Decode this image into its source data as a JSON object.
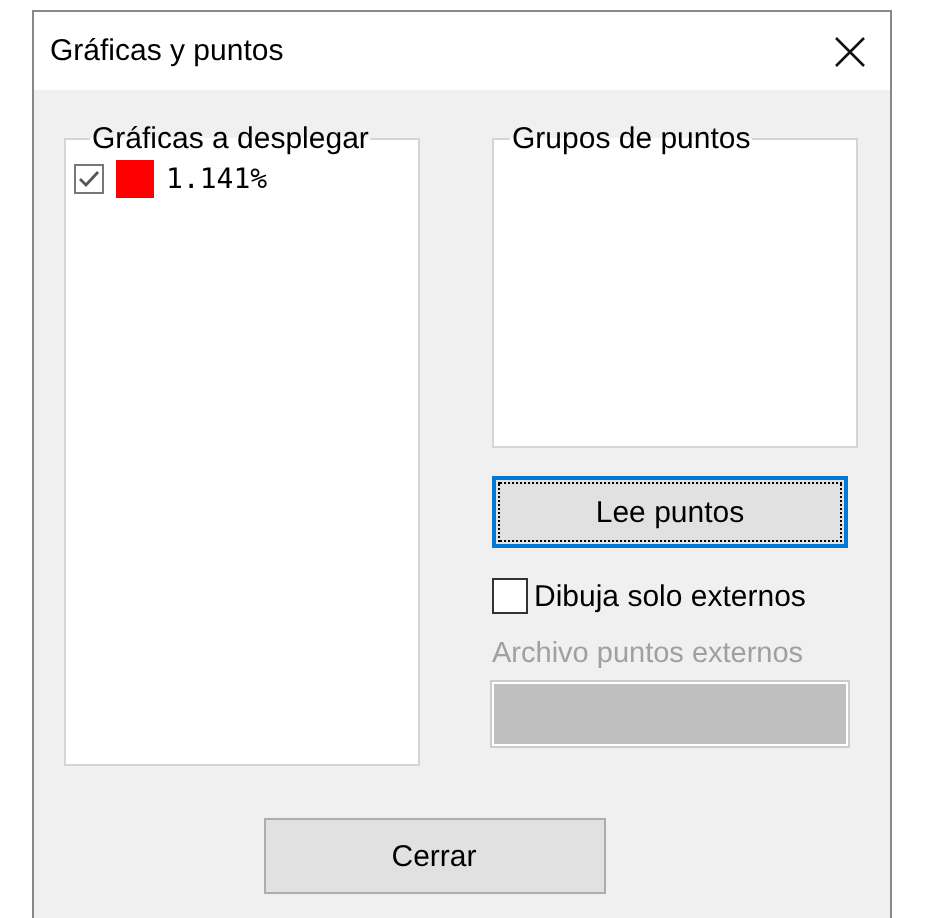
{
  "window": {
    "title": "Gráficas y puntos"
  },
  "graphs": {
    "label": "Gráficas a desplegar",
    "items": [
      {
        "checked": true,
        "color": "#ff0000",
        "label": "1.141%"
      }
    ]
  },
  "point_groups": {
    "label": "Grupos de puntos"
  },
  "read_button": {
    "label": "Lee puntos",
    "focused": true
  },
  "external_only": {
    "label": "Dibuja solo externos",
    "checked": false
  },
  "external_file": {
    "label": "Archivo puntos externos",
    "disabled": true
  },
  "close_button": {
    "label": "Cerrar"
  }
}
